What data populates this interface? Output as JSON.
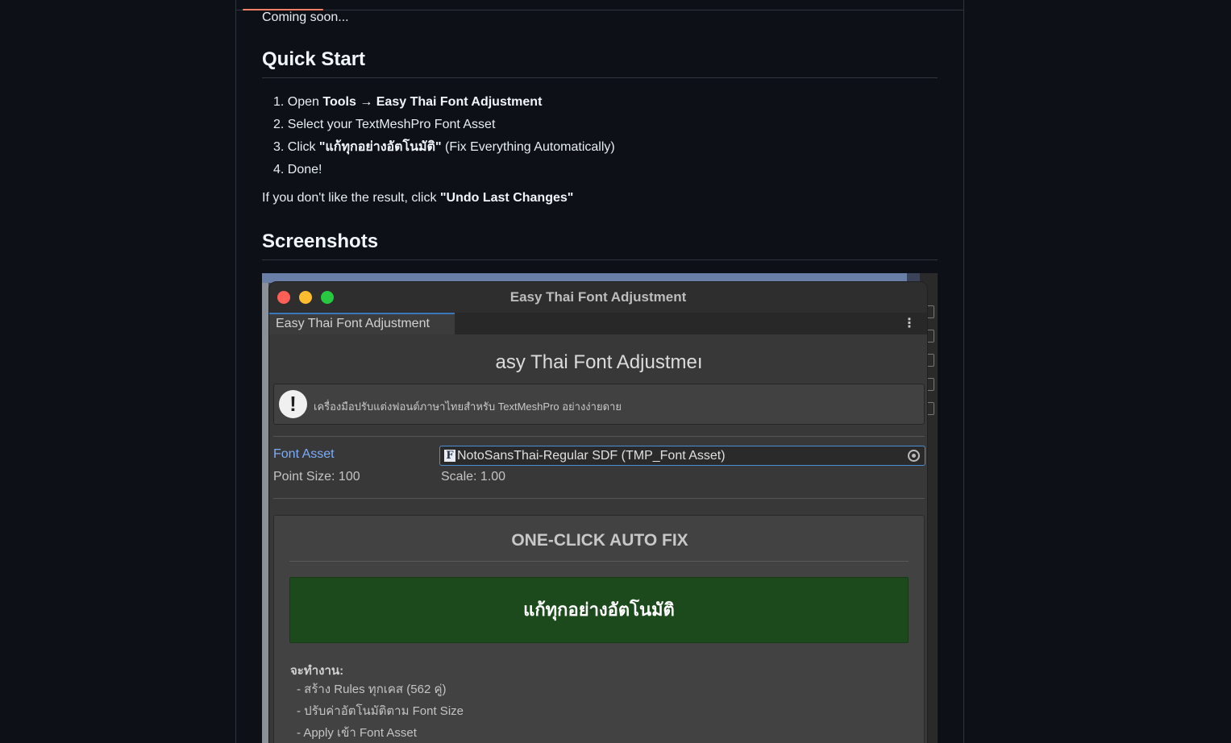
{
  "readme": {
    "coming_soon": "Coming soon...",
    "quick_start_heading": "Quick Start",
    "steps": [
      {
        "num": "1.",
        "text": "Open ",
        "bold": "Tools → Easy Thai Font Adjustment",
        "suffix": ""
      },
      {
        "num": "2.",
        "text": "Select your TextMeshPro Font Asset",
        "bold": "",
        "suffix": ""
      },
      {
        "num": "3.",
        "text": "Click ",
        "bold": "\"แก้ทุกอย่างอัตโนมัติ\"",
        "suffix": " (Fix Everything Automatically)"
      },
      {
        "num": "4.",
        "text": "Done!",
        "bold": "",
        "suffix": ""
      }
    ],
    "undo_prefix": "If you don't like the result, click ",
    "undo_bold": "\"Undo Last Changes\"",
    "screenshots_heading": "Screenshots"
  },
  "screenshot": {
    "window_title": "Easy Thai Font Adjustment",
    "tab_label": "Easy Thai Font Adjustment",
    "kebab": "⋮",
    "panel_title": "asy Thai Font Adjustmeı",
    "help_text": "เครื่องมือปรับแต่งฟอนต์ภาษาไทยสำหรับ TextMeshPro อย่างง่ายดาย",
    "help_icon": "!",
    "font_asset_label": "Font Asset",
    "font_asset_icon": "F",
    "font_asset_value": "NotoSansThai-Regular SDF (TMP_Font Asset)",
    "point_size": "Point Size: 100",
    "scale": "Scale: 1.00",
    "autofix_title": "ONE-CLICK AUTO FIX",
    "fix_button_label": "แก้ทุกอย่างอัตโนมัติ",
    "work_title": "จะทำงาน:",
    "work_items": [
      "- สร้าง Rules ทุกเคส (562 คู่)",
      "- ปรับค่าอัตโนมัติตาม Font Size",
      "- Apply เข้า Font Asset"
    ]
  },
  "colors": {
    "page_bg": "#0d1117",
    "accent_tab": "#f78166",
    "link_blue": "#7cacf8",
    "fix_button_green": "#1c4a1c"
  }
}
